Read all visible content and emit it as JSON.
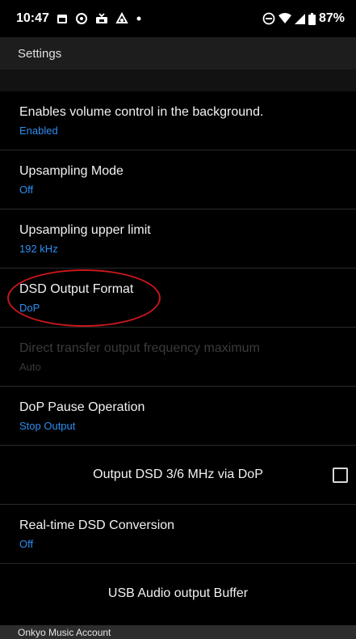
{
  "status_bar": {
    "time": "10:47",
    "battery": "87%",
    "left_icons": [
      "calendar-icon",
      "whatsapp-icon",
      "tv-icon",
      "outlook-icon",
      "dot-icon"
    ],
    "right_icons": [
      "do-not-disturb-icon",
      "wifi-icon",
      "signal-icon",
      "battery-icon"
    ]
  },
  "header": {
    "title": "Settings"
  },
  "settings": [
    {
      "title": "Enables volume control in the background.",
      "value": "Enabled"
    },
    {
      "title": "Upsampling Mode",
      "value": "Off"
    },
    {
      "title": "Upsampling upper limit",
      "value": "192 kHz"
    },
    {
      "title": "DSD Output Format",
      "value": "DoP"
    },
    {
      "title": "Direct transfer output frequency maximum",
      "value": "Auto",
      "disabled": true
    },
    {
      "title": "DoP Pause Operation",
      "value": "Stop Output"
    },
    {
      "title": "Output DSD 3/6 MHz via DoP",
      "checkbox": false
    },
    {
      "title": "Real-time DSD Conversion",
      "value": "Off"
    },
    {
      "title": "USB Audio output Buffer"
    }
  ],
  "footer": {
    "section_label": "Onkyo Music Account"
  },
  "colors": {
    "accent": "#2e8ef0",
    "highlight_ellipse": "#c9171c",
    "background": "#000000"
  }
}
